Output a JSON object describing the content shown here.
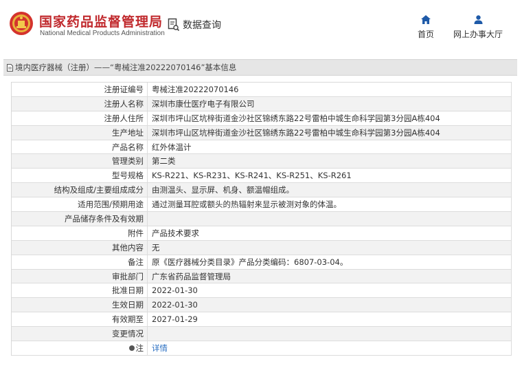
{
  "header": {
    "brand_cn": "国家药品监督管理局",
    "brand_en": "National Medical Products Administration",
    "query_label": "数据查询",
    "nav": [
      {
        "label": "首页",
        "icon": "home-icon"
      },
      {
        "label": "网上办事大厅",
        "icon": "user-icon"
      }
    ]
  },
  "titlebar": {
    "text": "境内医疗器械（注册）——“粤械注准20222070146”基本信息"
  },
  "details": {
    "rows": [
      {
        "label": "注册证编号",
        "value": "粤械注准20222070146"
      },
      {
        "label": "注册人名称",
        "value": "深圳市康仕医疗电子有限公司"
      },
      {
        "label": "注册人住所",
        "value": "深圳市坪山区坑梓街道金沙社区锦绣东路22号雷柏中城生命科学园第3分园A栋404"
      },
      {
        "label": "生产地址",
        "value": "深圳市坪山区坑梓街道金沙社区锦绣东路22号雷柏中城生命科学园第3分园A栋404"
      },
      {
        "label": "产品名称",
        "value": "红外体温计"
      },
      {
        "label": "管理类别",
        "value": "第二类"
      },
      {
        "label": "型号规格",
        "value": "KS-R221、KS-R231、KS-R241、KS-R251、KS-R261"
      },
      {
        "label": "结构及组成/主要组成成分",
        "value": "由测温头、显示屏、机身、额温帽组成。"
      },
      {
        "label": "适用范围/预期用途",
        "value": "通过测量耳腔或额头的热辐射来显示被测对象的体温。"
      },
      {
        "label": "产品储存条件及有效期",
        "value": ""
      },
      {
        "label": "附件",
        "value": "产品技术要求"
      },
      {
        "label": "其他内容",
        "value": "无"
      },
      {
        "label": "备注",
        "value": "原《医疗器械分类目录》产品分类编码：6807-03-04。"
      },
      {
        "label": "审批部门",
        "value": "广东省药品监督管理局"
      },
      {
        "label": "批准日期",
        "value": "2022-01-30"
      },
      {
        "label": "生效日期",
        "value": "2022-01-30"
      },
      {
        "label": "有效期至",
        "value": "2027-01-29"
      },
      {
        "label": "变更情况",
        "value": ""
      }
    ],
    "note": {
      "label": "注",
      "link": "详情"
    }
  }
}
